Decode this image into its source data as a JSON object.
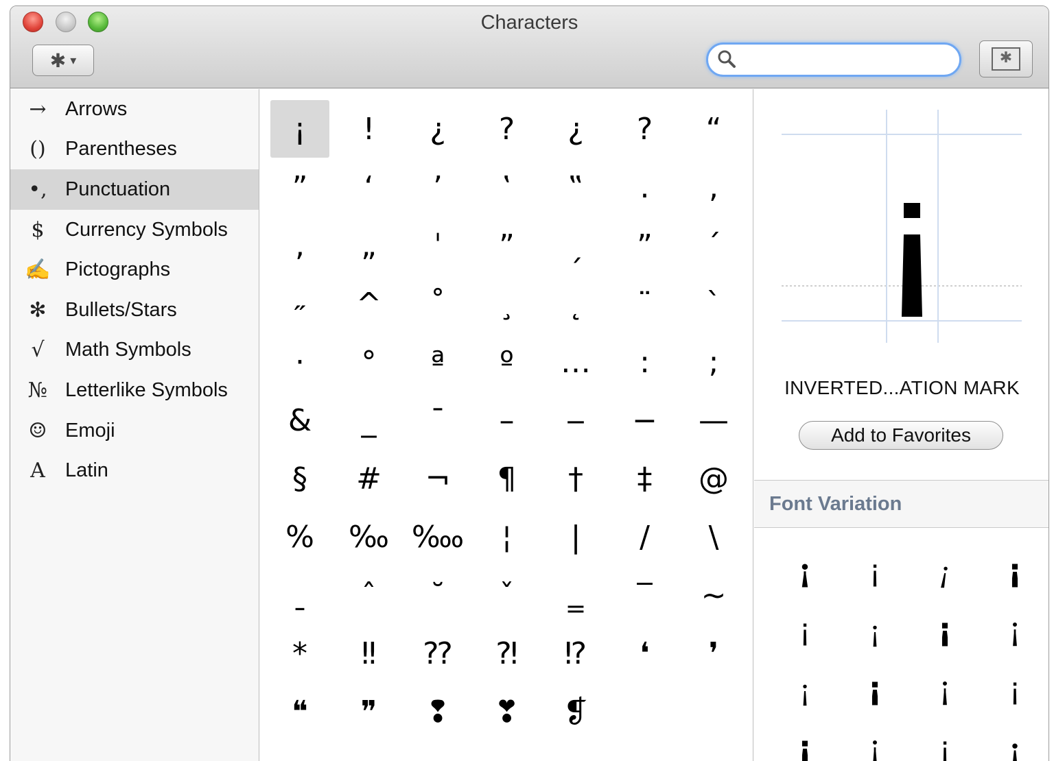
{
  "window": {
    "title": "Characters"
  },
  "toolbar": {
    "action_icon": "gear-icon",
    "action_glyph": "✱",
    "action_caret": "▾",
    "search_icon": "search-icon",
    "search_glyph": "⚲",
    "search_value": "",
    "keyboard_icon": "keyboard-viewer-icon",
    "keyboard_glyph": "✱"
  },
  "sidebar": {
    "items": [
      {
        "icon": "→",
        "label": "Arrows"
      },
      {
        "icon": "()",
        "label": "Parentheses"
      },
      {
        "icon": "•,",
        "label": "Punctuation"
      },
      {
        "icon": "$",
        "label": "Currency Symbols"
      },
      {
        "icon": "✍",
        "label": "Pictographs"
      },
      {
        "icon": "✻",
        "label": "Bullets/Stars"
      },
      {
        "icon": "√",
        "label": "Math Symbols"
      },
      {
        "icon": "№",
        "label": "Letterlike Symbols"
      },
      {
        "icon": "☺",
        "label": "Emoji"
      },
      {
        "icon": "A",
        "label": "Latin"
      }
    ],
    "selected": "Punctuation"
  },
  "grid": {
    "rows": [
      [
        "¡",
        "!",
        "¿",
        "?",
        "¿",
        "?",
        "“"
      ],
      [
        "”",
        "‘",
        "’",
        "‛",
        "‟",
        ".",
        ","
      ],
      [
        ",",
        "„",
        "ˈ",
        "ˮ",
        "ˏ",
        "ˮ",
        "ˊ"
      ],
      [
        "˶",
        "^",
        "˚",
        "¸",
        "˛",
        "¨",
        "ˋ"
      ],
      [
        "·",
        "°",
        "ª",
        "º",
        "…",
        ":",
        ";"
      ],
      [
        "&",
        "_",
        "¯",
        "–",
        "‒",
        "−",
        "—"
      ],
      [
        "§",
        "#",
        "¬",
        "¶",
        "†",
        "‡",
        "@"
      ],
      [
        "%",
        "‰",
        "‱",
        "¦",
        "|",
        "/",
        "\\"
      ],
      [
        "ˍ",
        "ˆ",
        "˘",
        "ˇ",
        "‗",
        "‾",
        "~"
      ],
      [
        "*",
        "‼",
        "⁇",
        "⁈",
        "⁉",
        "❛",
        "❜"
      ],
      [
        "❝",
        "❞",
        "❢",
        "❣",
        "❡",
        "",
        ""
      ]
    ],
    "selected_char": "¡"
  },
  "detail": {
    "preview_char": "¡",
    "char_name": "INVERTED...ATION MARK",
    "add_favorites_label": "Add to Favorites",
    "font_variation_title": "Font Variation",
    "variations": [
      "¡",
      "¡",
      "¡",
      "¡",
      "¡",
      "¡",
      "¡",
      "¡",
      "¡",
      "¡",
      "¡",
      "¡",
      "¡",
      "¡",
      "¡",
      "¡"
    ]
  }
}
